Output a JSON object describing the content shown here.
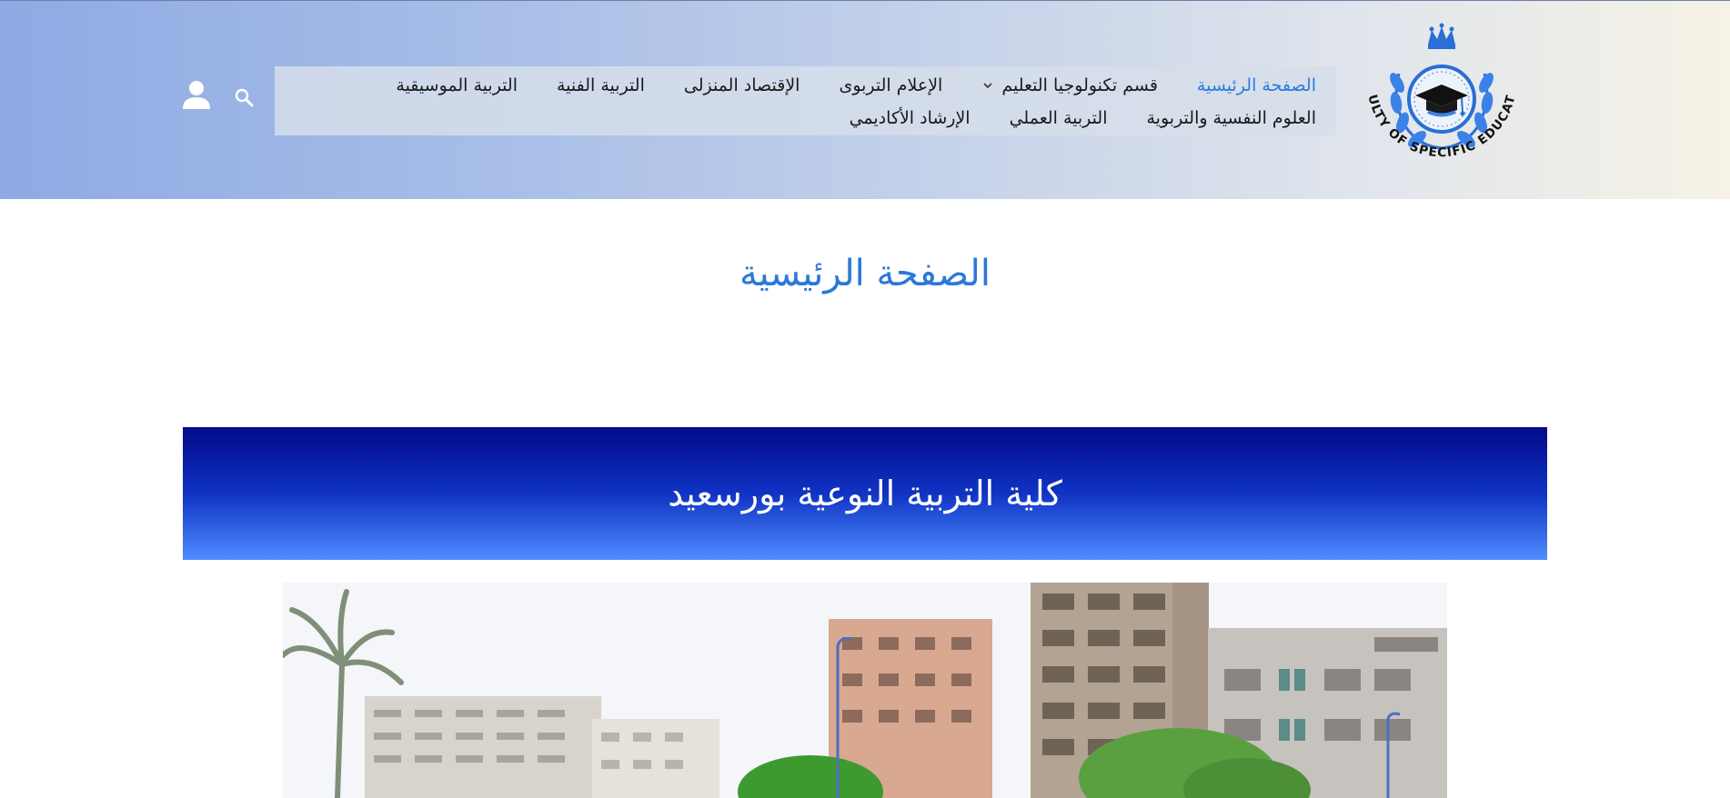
{
  "header": {
    "logo_text": "FACULTY OF SPECIFIC EDUCATION",
    "nav_row1": [
      {
        "label": "الصفحة الرئيسية",
        "active": true
      },
      {
        "label": "قسم تكنولوجيا التعليم",
        "dropdown": true
      },
      {
        "label": "الإعلام التربوى"
      },
      {
        "label": "الإقتصاد المنزلى"
      },
      {
        "label": "التربية الفنية"
      },
      {
        "label": "التربية الموسيقية"
      }
    ],
    "nav_row2": [
      {
        "label": "العلوم النفسية والتربوية"
      },
      {
        "label": "التربية العملي"
      },
      {
        "label": "الإرشاد الأكاديمي"
      }
    ],
    "search_icon": "search-icon",
    "user_icon": "user-icon"
  },
  "main": {
    "page_title": "الصفحة الرئيسية",
    "banner_title": "كلية التربية النوعية بورسعيد"
  },
  "colors": {
    "accent": "#2b7be0",
    "banner_top": "#030a8a",
    "banner_bottom": "#4d8cff"
  }
}
